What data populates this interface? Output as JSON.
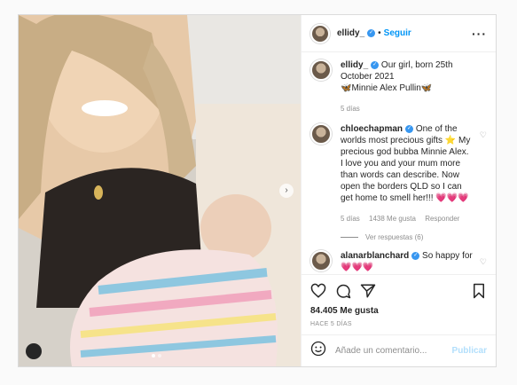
{
  "post": {
    "username": "ellidy_",
    "follow_label": "Seguir",
    "more_icon": "more-horizontal-icon"
  },
  "caption": {
    "username": "ellidy_",
    "text": "Our girl, born 25th October 2021",
    "line2": "🦋Minnie Alex Pullin🦋",
    "time": "5 días"
  },
  "comments": [
    {
      "username": "chloechapman",
      "text": "One of the worlds most precious gifts ⭐ My precious god bubba Minnie Alex. I love you and your mum more than words can describe. Now open the borders QLD so I can get home to smell her!!! 💗💗💗",
      "time": "5 días",
      "likes": "1438 Me gusta",
      "reply_label": "Responder",
      "view_replies": "Ver respuestas (6)"
    },
    {
      "username": "alanarblanchard",
      "text": "So happy for",
      "tail": "💗💗💗"
    }
  ],
  "likes": "84.405 Me gusta",
  "posted": "HACE 5 DÍAS",
  "add_comment": {
    "placeholder": "Añade un comentario...",
    "publish_label": "Publicar"
  }
}
